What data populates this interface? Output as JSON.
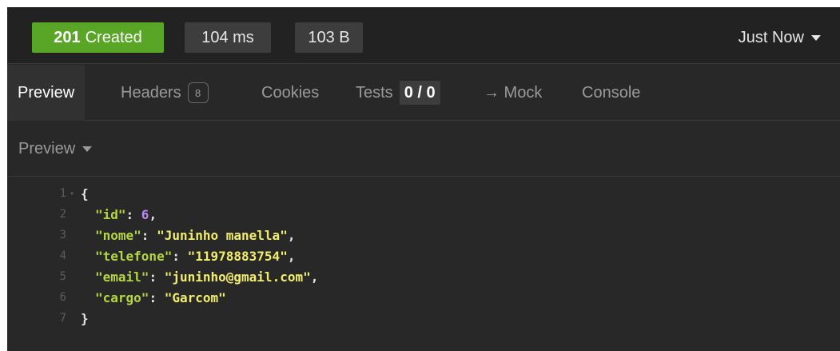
{
  "status_bar": {
    "status_code": "201",
    "status_text": "Created",
    "time": "104 ms",
    "size": "103 B",
    "timestamp": "Just Now"
  },
  "tabs": {
    "preview": "Preview",
    "headers": "Headers",
    "headers_count": "8",
    "cookies": "Cookies",
    "tests": "Tests",
    "tests_count": "0 / 0",
    "mock": "→ Mock",
    "console": "Console"
  },
  "mode": {
    "label": "Preview"
  },
  "code": {
    "lines": [
      {
        "n": "1",
        "open": "{"
      },
      {
        "n": "2",
        "key": "\"id\"",
        "value": "6",
        "sep": ","
      },
      {
        "n": "3",
        "key": "\"nome\"",
        "value": "\"Juninho manella\"",
        "sep": ","
      },
      {
        "n": "4",
        "key": "\"telefone\"",
        "value": "\"11978883754\"",
        "sep": ","
      },
      {
        "n": "5",
        "key": "\"email\"",
        "value": "\"juninho@gmail.com\"",
        "sep": ","
      },
      {
        "n": "6",
        "key": "\"cargo\"",
        "value": "\"Garcom\"",
        "sep": ""
      },
      {
        "n": "7",
        "close": "}"
      }
    ]
  },
  "colors": {
    "status_success": "#59a627",
    "json_key": "#b6d63f",
    "json_string": "#f2ee6b",
    "json_number": "#b98bf5"
  }
}
